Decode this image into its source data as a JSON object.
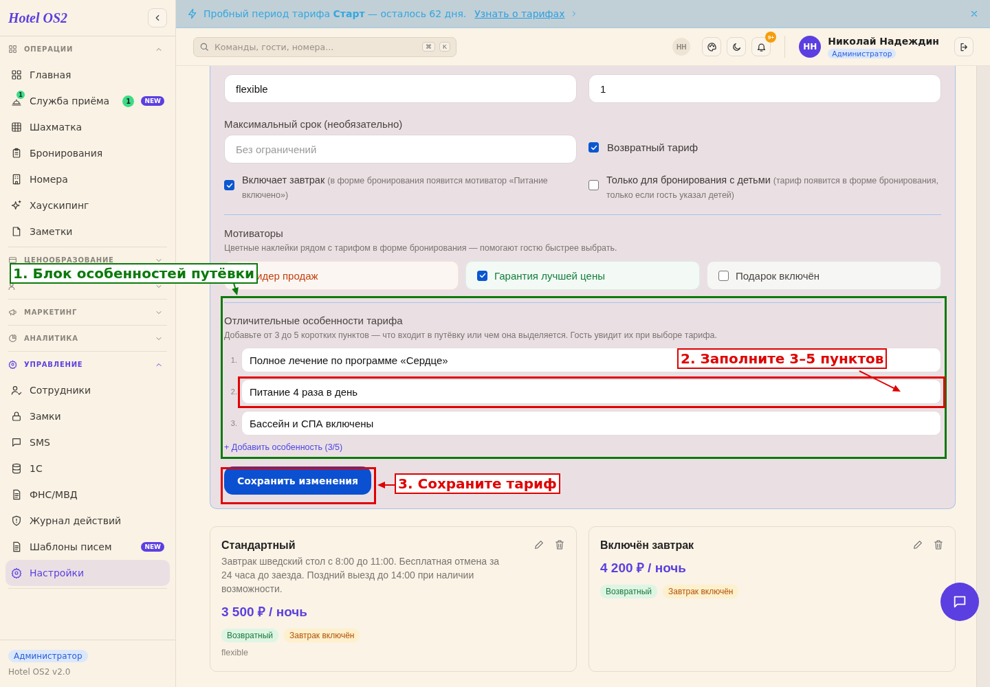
{
  "sidebar": {
    "logo": "Hotel OS2",
    "sections": [
      {
        "label": "ОПЕРАЦИИ",
        "expanded": true,
        "items": [
          {
            "label": "Главная",
            "selected": false
          },
          {
            "label": "Служба приёма",
            "selected": false,
            "icon_badge": "1",
            "count": "1",
            "tag": "NEW"
          },
          {
            "label": "Шахматка",
            "selected": false
          },
          {
            "label": "Бронирования",
            "selected": false
          },
          {
            "label": "Номера",
            "selected": false
          },
          {
            "label": "Хаускипинг",
            "selected": false
          },
          {
            "label": "Заметки",
            "selected": false
          }
        ]
      },
      {
        "label": "ЦЕНООБРАЗОВАНИЕ",
        "expanded": false
      },
      {
        "expanded": false
      },
      {
        "label": "МАРКЕТИНГ",
        "expanded": false
      },
      {
        "label": "АНАЛИТИКА",
        "expanded": false
      },
      {
        "label": "УПРАВЛЕНИЕ",
        "expanded": true,
        "items": [
          {
            "label": "Сотрудники",
            "selected": false
          },
          {
            "label": "Замки",
            "selected": false
          },
          {
            "label": "SMS",
            "selected": false
          },
          {
            "label": "1С",
            "selected": false
          },
          {
            "label": "ФНС/МВД",
            "selected": false
          },
          {
            "label": "Журнал действий",
            "selected": false
          },
          {
            "label": "Шаблоны писем",
            "selected": false,
            "tag": "NEW"
          },
          {
            "label": "Настройки",
            "selected": true
          }
        ]
      }
    ],
    "footer": {
      "role": "Администратор",
      "version": "Hotel OS2 v2.0"
    }
  },
  "banner": {
    "text": "Пробный период тарифа **Старт** — осталось 62 дня.",
    "link": "Узнать о тарифах"
  },
  "header": {
    "search": {
      "placeholder": "Команды, гости, номера...",
      "keys": [
        "⌘",
        "K"
      ]
    },
    "initials_chip": "НН",
    "notifications": "9+",
    "user": {
      "initials": "НН",
      "name": "Николай Надеждин",
      "role": "Администратор"
    }
  },
  "form": {
    "fields_top": [
      {
        "value": "flexible"
      },
      {
        "value": "1"
      }
    ],
    "max_stay": {
      "label": "Максимальный срок (необязательно)",
      "placeholder": "Без ограничений"
    },
    "refundable": {
      "label": "Возвратный тариф",
      "checked": true
    },
    "options": [
      {
        "label": "Включает завтрак",
        "hint": "(в форме бронирования появится мотиватор «Питание включено»)",
        "checked": true
      },
      {
        "label": "Только для бронирования с детьми",
        "hint": "(тариф появится в форме бронирования, только если гость указал детей)",
        "checked": false
      }
    ],
    "motivators": {
      "title": "Мотиваторы",
      "subtitle": "Цветные наклейки рядом с тарифом в форме бронирования — помогают гостю быстрее выбрать.",
      "items": [
        {
          "label": "идер продаж",
          "color": "#c2410c"
        },
        {
          "label": "Гарантия лучшей цены",
          "checked": true,
          "color": "#15803d"
        },
        {
          "label": "Подарок включён",
          "checked": false,
          "color": "#4a4540"
        }
      ]
    },
    "features": {
      "title": "Отличительные особенности тарифа",
      "subtitle": "Добавьте от 3 до 5 коротких пунктов — что входит в путёвку или чем она выделяется. Гость увидит их при выборе тарифа.",
      "items": [
        {
          "number": "1.",
          "value": "Полное лечение по программе «Сердце»"
        },
        {
          "number": "2.",
          "value": "Питание 4 раза в день"
        },
        {
          "number": "3.",
          "value": "Бассейн и СПА включены"
        }
      ],
      "add_link": "+ Добавить особенность (3/5)"
    },
    "save_button": "Сохранить изменения"
  },
  "tariffs": [
    {
      "name": "Стандартный",
      "description": "Завтрак шведский стол с 8:00 до 11:00. Бесплатная отмена за 24 часа до заезда. Поздний выезд до 14:00 при наличии возможности.",
      "price": "3 500 ₽ / ночь",
      "tags": [
        {
          "label": "Возвратный",
          "kind": "refund"
        },
        {
          "label": "Завтрак включён",
          "kind": "meal"
        }
      ],
      "policy": "flexible"
    },
    {
      "name": "Включён завтрак",
      "price": "4 200 ₽ / ночь",
      "tags": [
        {
          "label": "Возвратный",
          "kind": "refund"
        },
        {
          "label": "Завтрак включён",
          "kind": "meal"
        }
      ]
    }
  ],
  "annotations": [
    {
      "kind": "callout",
      "text": "1. Блок особенностей путёвки",
      "color": "#0a7a0a"
    },
    {
      "kind": "frame",
      "color": "#0a7a0a"
    },
    {
      "kind": "callout",
      "text": "2. Заполните 3–5 пунктов",
      "color": "#e00000"
    },
    {
      "kind": "frame",
      "color": "#e00000"
    },
    {
      "kind": "frame",
      "color": "#e00000"
    },
    {
      "kind": "callout",
      "text": "3. Сохраните тариф",
      "color": "#e00000"
    }
  ]
}
